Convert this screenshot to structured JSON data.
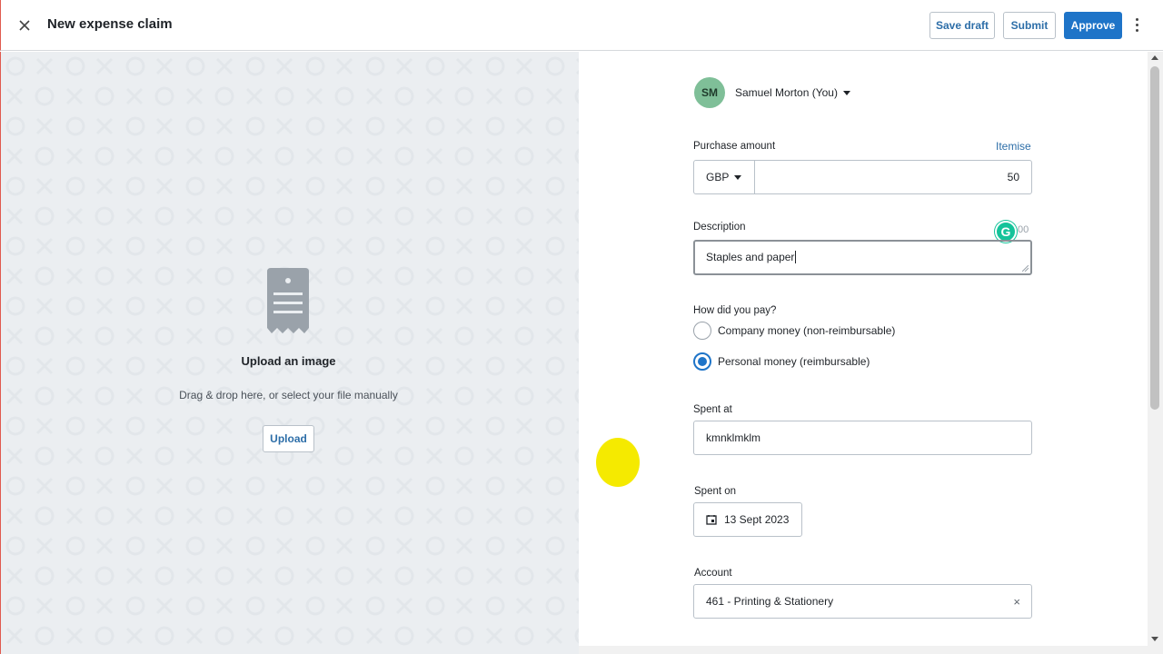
{
  "header": {
    "title": "New expense claim",
    "buttons": {
      "save_draft": "Save draft",
      "submit": "Submit",
      "approve": "Approve"
    }
  },
  "upload": {
    "title": "Upload an image",
    "subtitle": "Drag & drop here, or select your file manually",
    "button": "Upload"
  },
  "form": {
    "user": {
      "initials": "SM",
      "name": "Samuel Morton (You)"
    },
    "purchase_amount": {
      "label": "Purchase amount",
      "itemise_link": "Itemise",
      "currency": "GBP",
      "value": "50"
    },
    "description": {
      "label": "Description",
      "counter_fragment": "00",
      "value": "Staples and paper"
    },
    "payment": {
      "label": "How did you pay?",
      "options": [
        {
          "label": "Company money (non-reimbursable)",
          "selected": false
        },
        {
          "label": "Personal money (reimbursable)",
          "selected": true
        }
      ]
    },
    "spent_at": {
      "label": "Spent at",
      "value": "kmnklmklm"
    },
    "spent_on": {
      "label": "Spent on",
      "value": "13 Sept 2023"
    },
    "account": {
      "label": "Account",
      "value": "461 - Printing & Stationery"
    }
  },
  "colors": {
    "primary": "#1e74c8",
    "link": "#2d6ea8",
    "avatar": "#7fbf98",
    "grammarly": "#15c39a",
    "cursor_highlight": "#f5ea00"
  }
}
